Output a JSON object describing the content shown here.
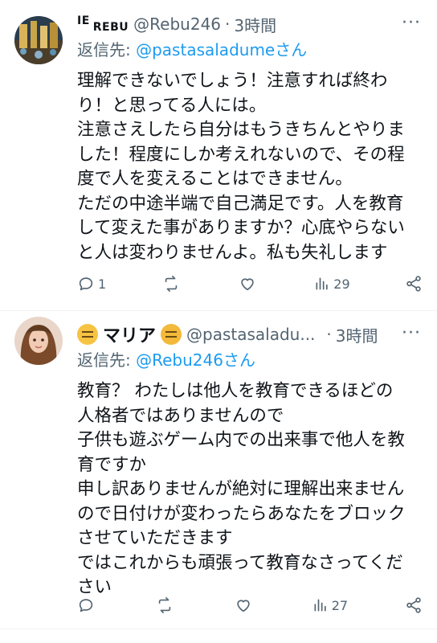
{
  "tweets": [
    {
      "display_name_prefix": "IE",
      "display_name": "REBU",
      "handle": "@Rebu246",
      "separator": "·",
      "time": "3時間",
      "reply_label": "返信先: ",
      "reply_mention": "@pastasaladumeさん",
      "lines": [
        "理解できないでしょう！注意すれば終わ",
        "り！と思ってる人には。",
        "注意さえしたら自分はもうきちんとやりま",
        "した！程度にしか考えれないので、その程",
        "度で人を変えることはできません。",
        "ただの中途半端で自己満足です。人を教育",
        "して変えた事がありますか？心底やらない",
        "と人は変わりませんよ。私も失礼します"
      ],
      "actions": {
        "reply_count": "1",
        "retweet_count": "",
        "like_count": "",
        "views_count": "29"
      }
    },
    {
      "display_name": "マリア",
      "handle": "@pastasaladu...",
      "separator": "·",
      "time": "3時間",
      "reply_label": "返信先: ",
      "reply_mention": "@Rebu246さん",
      "lines": [
        "教育？ わたしは他人を教育できるほどの",
        "人格者ではありませんので",
        "子供も遊ぶゲーム内での出来事で他人を教",
        "育ですか",
        "申し訳ありませんが絶対に理解出来ません",
        "ので日付けが変わったらあなたをブロック",
        "させていただきます",
        "ではこれからも頑張って教育なさってくだ",
        "さい"
      ],
      "actions": {
        "reply_count": "",
        "retweet_count": "",
        "like_count": "",
        "views_count": "27"
      }
    }
  ],
  "icons": {
    "more": "more-icon",
    "reply": "reply-icon",
    "retweet": "retweet-icon",
    "like": "like-icon",
    "views": "views-icon",
    "share": "share-icon"
  },
  "colors": {
    "accent": "#1d9bf0",
    "secondary_text": "#536471",
    "text": "#0f1419",
    "divider": "#eff3f4"
  }
}
